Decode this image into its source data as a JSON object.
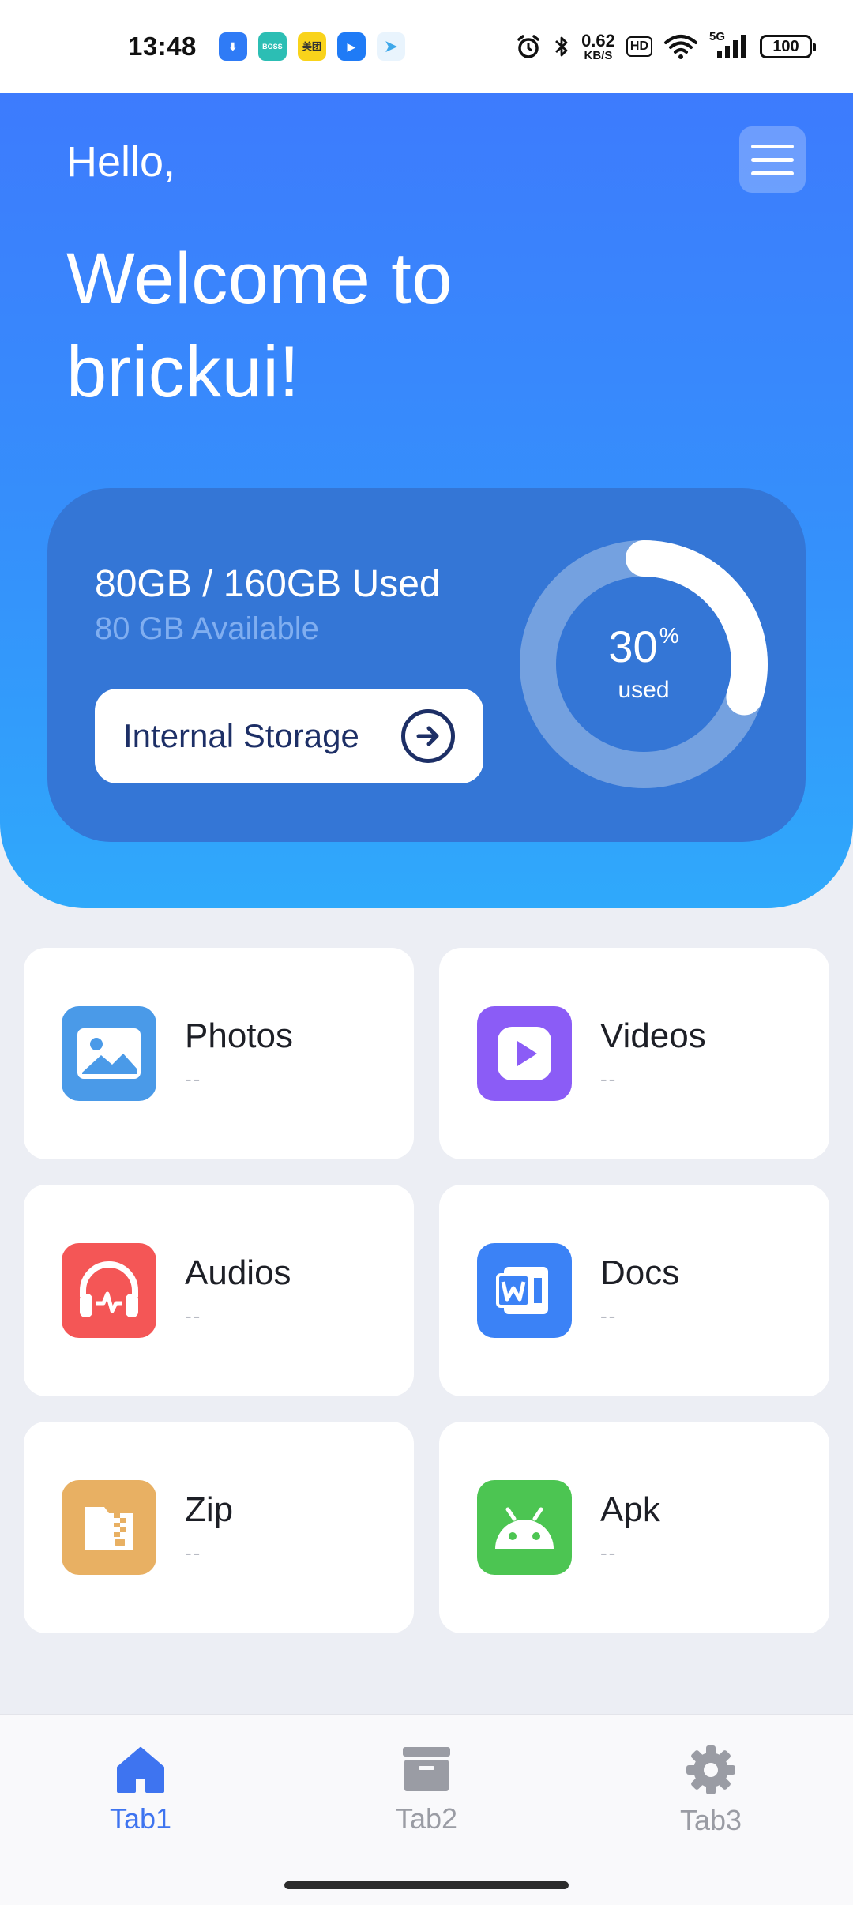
{
  "status_bar": {
    "time": "13:48",
    "notification_icons": [
      {
        "name": "download-app-icon",
        "label": "⬇",
        "color": "#2f7bf6"
      },
      {
        "name": "boss-app-icon",
        "label": "BOSS",
        "color": "#2cbeb4"
      },
      {
        "name": "meituan-app-icon",
        "label": "美团",
        "color": "#f9d31b"
      },
      {
        "name": "map-app-icon",
        "label": "▶",
        "color": "#1f7bf6"
      },
      {
        "name": "telegram-app-icon",
        "label": "➤",
        "color": "#3fa8ea"
      }
    ],
    "net_speed_value": "0.62",
    "net_speed_unit": "KB/S",
    "hd_label": "HD",
    "network_label": "5G",
    "battery": "100"
  },
  "hero": {
    "greeting": "Hello,",
    "welcome": "Welcome to brickui!",
    "menu_icon": "hamburger-menu-icon"
  },
  "storage": {
    "used_summary": "80GB / 160GB Used",
    "available": "80 GB Available",
    "button_label": "Internal Storage",
    "percent": "30",
    "percent_symbol": "%",
    "percent_label": "used",
    "percent_fraction": 0.3
  },
  "categories": [
    {
      "title": "Photos",
      "sub": "--",
      "icon": "image-icon",
      "color": "#4a9ae8"
    },
    {
      "title": "Videos",
      "sub": "--",
      "icon": "play-icon",
      "color": "#8b5cf6"
    },
    {
      "title": "Audios",
      "sub": "--",
      "icon": "headphones-icon",
      "color": "#f45656"
    },
    {
      "title": "Docs",
      "sub": "--",
      "icon": "word-doc-icon",
      "color": "#3b82f6"
    },
    {
      "title": "Zip",
      "sub": "--",
      "icon": "zip-folder-icon",
      "color": "#e8b063"
    },
    {
      "title": "Apk",
      "sub": "--",
      "icon": "android-icon",
      "color": "#4cc552"
    }
  ],
  "tabs": [
    {
      "label": "Tab1",
      "icon": "home-icon",
      "active": true
    },
    {
      "label": "Tab2",
      "icon": "archive-box-icon",
      "active": false
    },
    {
      "label": "Tab3",
      "icon": "gear-icon",
      "active": false
    }
  ],
  "colors": {
    "accent": "#3d7bfd",
    "tab_active": "#3e74f0",
    "tab_inactive": "#9a9ca4"
  }
}
